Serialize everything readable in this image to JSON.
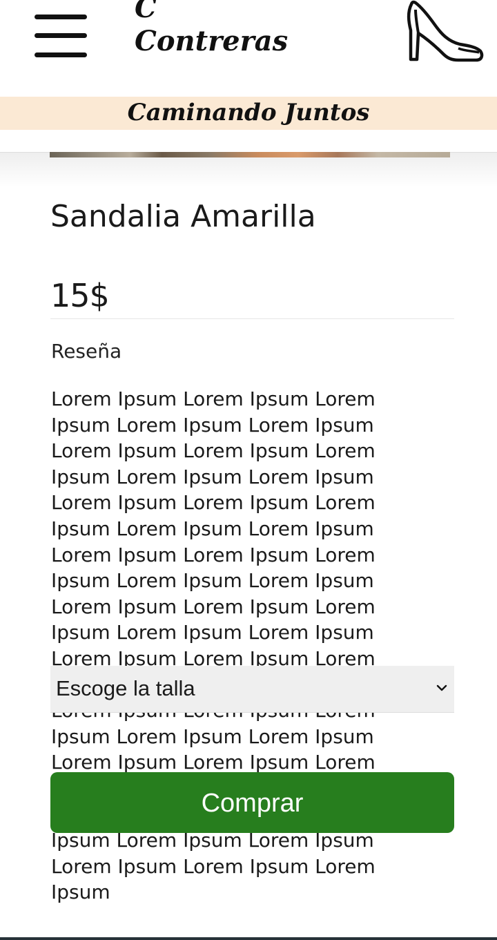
{
  "header": {
    "brand_line1": "C",
    "brand_line2": "Contreras",
    "menu_icon": "hamburger-menu-icon",
    "cart_icon": "high-heel-shoe-icon",
    "tagline": "Caminando Juntos"
  },
  "product": {
    "name": "Sandalia Amarilla",
    "price": "15$",
    "review_label": "Reseña",
    "review_text": "Lorem Ipsum Lorem Ipsum Lorem Ipsum Lorem Ipsum Lorem Ipsum Lorem Ipsum Lorem Ipsum Lorem Ipsum Lorem Ipsum Lorem Ipsum Lorem Ipsum Lorem Ipsum Lorem Ipsum Lorem Ipsum Lorem Ipsum Lorem Ipsum Lorem Ipsum Lorem Ipsum Lorem Ipsum Lorem Ipsum Lorem Ipsum Lorem Ipsum Lorem Ipsum Lorem Ipsum Lorem Ipsum Lorem Ipsum Lorem Ipsum Lorem Ipsum Lorem Ipsum Lorem Ipsum Lorem Ipsum Lorem Ipsum Lorem Ipsum Lorem Ipsum Lorem Ipsum Lorem Ipsum Lorem Ipsum Lorem Ipsum Lorem Ipsum Lorem Ipsum Lorem Ipsum Lorem Ipsum Lorem Ipsum Lorem Ipsum Lorem Ipsum Lorem Ipsum Lorem Ipsum Lorem Ipsum"
  },
  "size_select": {
    "selected": "Escoge la talla",
    "icon": "chevron-down-icon"
  },
  "actions": {
    "buy_label": "Comprar"
  },
  "colors": {
    "tagline_band": "#fbe9d4",
    "buy_button": "#277e1e",
    "select_background": "#efefef"
  }
}
